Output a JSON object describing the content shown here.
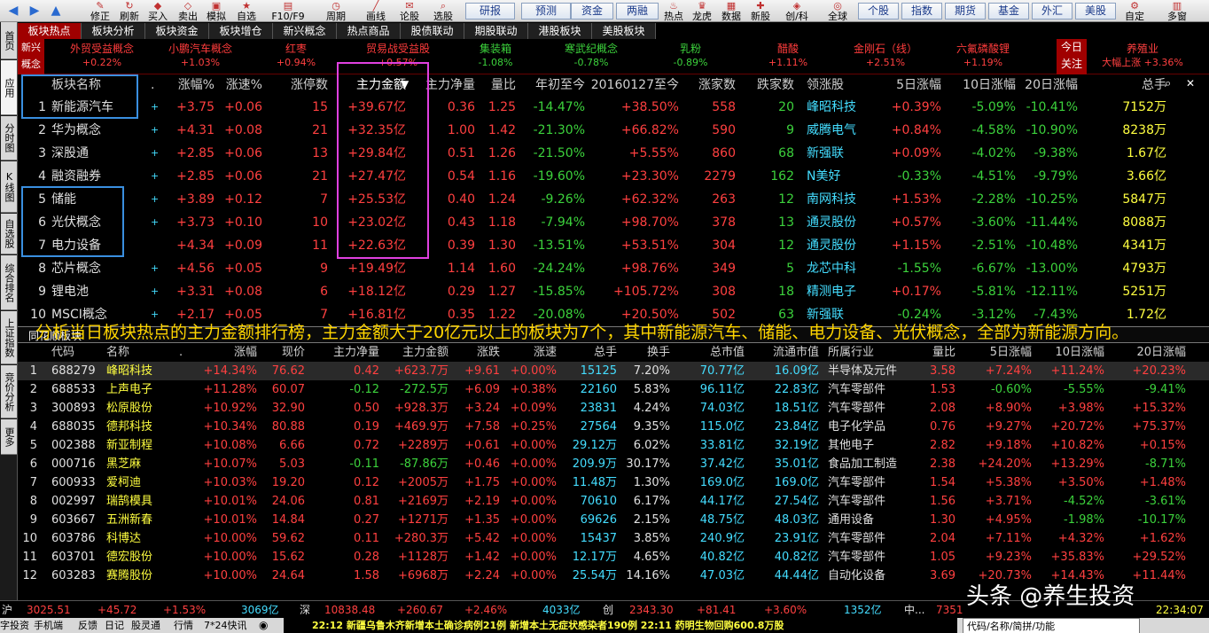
{
  "toolbar": {
    "buttons": [
      "修正",
      "刷新",
      "买入",
      "卖出",
      "模拟",
      "自选",
      "F10/F9",
      "周期",
      "画线",
      "论股",
      "选股"
    ],
    "boxes": [
      "研报",
      "预测",
      "资金",
      "两融"
    ],
    "buttons2": [
      "热点",
      "龙虎",
      "数据",
      "新股",
      "创/科",
      "全球"
    ],
    "boxes2": [
      "个股",
      "指数",
      "期货",
      "基金",
      "外汇",
      "美股"
    ],
    "right": [
      "自定",
      "多窗"
    ]
  },
  "leftbar": [
    "首页",
    "应用",
    "分时图",
    "K线图",
    "自选股",
    "综合排名",
    "上证指数",
    "竞价分析",
    "更多"
  ],
  "tabs": [
    "板块热点",
    "板块分析",
    "板块资金",
    "板块增仓",
    "新兴概念",
    "热点商品",
    "股债联动",
    "期股联动",
    "港股板块",
    "美股板块"
  ],
  "hot": {
    "label": "新兴概念",
    "items": [
      {
        "name": "外贸受益概念",
        "val": "+0.22%",
        "up": true
      },
      {
        "name": "小鹏汽车概念",
        "val": "+1.03%",
        "up": true
      },
      {
        "name": "红枣",
        "val": "+0.94%",
        "up": true
      },
      {
        "name": "贸易战受益股",
        "val": "+0.57%",
        "up": true
      },
      {
        "name": "集装箱",
        "val": "-1.08%",
        "up": false
      },
      {
        "name": "寒武纪概念",
        "val": "-0.78%",
        "up": false
      },
      {
        "name": "乳粉",
        "val": "-0.89%",
        "up": false
      },
      {
        "name": "醋酸",
        "val": "+1.11%",
        "up": true
      },
      {
        "name": "金刚石（线）",
        "val": "+2.51%",
        "up": true
      },
      {
        "name": "六氟磷酸锂",
        "val": "+1.19%",
        "up": true
      }
    ],
    "today": "今日关注",
    "today_item": {
      "name": "养殖业",
      "sub": "大幅上涨",
      "val": "+3.36%"
    }
  },
  "upper": {
    "headers": [
      "板块名称",
      ".",
      "涨幅%",
      "涨速%",
      "涨停数",
      "主力金额",
      "主力净量",
      "量比",
      "年初至今",
      "20160127至今",
      "涨家数",
      "跌家数",
      "领涨股",
      "5日涨幅",
      "10日涨幅",
      "20日涨幅",
      "总手"
    ],
    "rows": [
      {
        "i": "1",
        "n": "新能源汽车",
        "z": "+3.75",
        "s": "+0.06",
        "t": "15",
        "je": "+39.67亿",
        "jl": "0.36",
        "lb": "1.25",
        "nc": "-14.47%",
        "lj": "+38.50%",
        "zj": "558",
        "dj": "20",
        "lz": "峰昭科技",
        "d5": "+0.39%",
        "d10": "-5.09%",
        "d20": "-10.41%",
        "zs": "7152万",
        "p": "+"
      },
      {
        "i": "2",
        "n": "华为概念",
        "z": "+4.31",
        "s": "+0.08",
        "t": "21",
        "je": "+32.35亿",
        "jl": "1.00",
        "lb": "1.42",
        "nc": "-21.30%",
        "lj": "+66.82%",
        "zj": "590",
        "dj": "9",
        "lz": "威腾电气",
        "d5": "+0.84%",
        "d10": "-4.58%",
        "d20": "-10.90%",
        "zs": "8238万",
        "p": "+"
      },
      {
        "i": "3",
        "n": "深股通",
        "z": "+2.85",
        "s": "+0.06",
        "t": "13",
        "je": "+29.84亿",
        "jl": "0.51",
        "lb": "1.26",
        "nc": "-21.50%",
        "lj": "+5.55%",
        "zj": "860",
        "dj": "68",
        "lz": "新强联",
        "d5": "+0.09%",
        "d10": "-4.02%",
        "d20": "-9.38%",
        "zs": "1.67亿",
        "p": "+"
      },
      {
        "i": "4",
        "n": "融资融券",
        "z": "+2.85",
        "s": "+0.06",
        "t": "21",
        "je": "+27.47亿",
        "jl": "0.54",
        "lb": "1.16",
        "nc": "-19.60%",
        "lj": "+23.30%",
        "zj": "2279",
        "dj": "162",
        "lz": "N美好",
        "d5": "-0.33%",
        "d10": "-4.51%",
        "d20": "-9.79%",
        "zs": "3.66亿",
        "p": "+"
      },
      {
        "i": "5",
        "n": "储能",
        "z": "+3.89",
        "s": "+0.12",
        "t": "7",
        "je": "+25.53亿",
        "jl": "0.40",
        "lb": "1.24",
        "nc": "-9.26%",
        "lj": "+62.32%",
        "zj": "263",
        "dj": "12",
        "lz": "南网科技",
        "d5": "+1.53%",
        "d10": "-2.28%",
        "d20": "-10.25%",
        "zs": "5847万",
        "p": "+"
      },
      {
        "i": "6",
        "n": "光伏概念",
        "z": "+3.73",
        "s": "+0.10",
        "t": "10",
        "je": "+23.02亿",
        "jl": "0.43",
        "lb": "1.18",
        "nc": "-7.94%",
        "lj": "+98.70%",
        "zj": "378",
        "dj": "13",
        "lz": "通灵股份",
        "d5": "+0.57%",
        "d10": "-3.60%",
        "d20": "-11.44%",
        "zs": "8088万",
        "p": "+"
      },
      {
        "i": "7",
        "n": "电力设备",
        "z": "+4.34",
        "s": "+0.09",
        "t": "11",
        "je": "+22.63亿",
        "jl": "0.39",
        "lb": "1.30",
        "nc": "-13.51%",
        "lj": "+53.51%",
        "zj": "304",
        "dj": "12",
        "lz": "通灵股份",
        "d5": "+1.15%",
        "d10": "-2.51%",
        "d20": "-10.48%",
        "zs": "4341万",
        "p": ""
      },
      {
        "i": "8",
        "n": "芯片概念",
        "z": "+4.56",
        "s": "+0.05",
        "t": "9",
        "je": "+19.49亿",
        "jl": "1.14",
        "lb": "1.60",
        "nc": "-24.24%",
        "lj": "+98.76%",
        "zj": "349",
        "dj": "5",
        "lz": "龙芯中科",
        "d5": "-1.55%",
        "d10": "-6.67%",
        "d20": "-13.00%",
        "zs": "4793万",
        "p": "+"
      },
      {
        "i": "9",
        "n": "锂电池",
        "z": "+3.31",
        "s": "+0.08",
        "t": "6",
        "je": "+18.12亿",
        "jl": "0.29",
        "lb": "1.27",
        "nc": "-15.85%",
        "lj": "+105.72%",
        "zj": "308",
        "dj": "18",
        "lz": "精测电子",
        "d5": "+0.17%",
        "d10": "-5.81%",
        "d20": "-12.11%",
        "zs": "5251万",
        "p": "+"
      },
      {
        "i": "10",
        "n": "MSCI概念",
        "z": "+2.17",
        "s": "+0.05",
        "t": "7",
        "je": "+16.81亿",
        "jl": "0.35",
        "lb": "1.22",
        "nc": "-20.08%",
        "lj": "+20.50%",
        "zj": "502",
        "dj": "63",
        "lz": "新强联",
        "d5": "-0.24%",
        "d10": "-3.12%",
        "d20": "-7.43%",
        "zs": "1.72亿",
        "p": "+"
      }
    ]
  },
  "divider": {
    "left": "同花顺板块"
  },
  "overlay": "分析当日板块热点的主力金额排行榜，主力金额大于20亿元以上的板块为7个，其中新能源汽车、储能、电力设备、光伏概念，全部为新能源方向。",
  "lower": {
    "headers": [
      "代码",
      "名称",
      ".",
      "涨幅",
      "现价",
      "主力净量",
      "主力金额",
      "涨跌",
      "涨速",
      "总手",
      "换手",
      "总市值",
      "流通市值",
      "所属行业",
      "量比",
      "5日涨幅",
      "10日涨幅",
      "20日涨幅"
    ],
    "rows": [
      {
        "i": "1",
        "code": "688279",
        "n": "峰昭科技",
        "z": "+14.34%",
        "p": "76.62",
        "jl": "0.42",
        "je": "+623.7万",
        "zd": "+9.61",
        "zs": "+0.00%",
        "zsh": "15125",
        "hs": "7.20%",
        "sz": "70.77亿",
        "lt": "16.09亿",
        "hy": "半导体及元件",
        "lb": "3.58",
        "d5": "+7.24%",
        "d10": "+11.24%",
        "d20": "+20.23%"
      },
      {
        "i": "2",
        "code": "688533",
        "n": "上声电子",
        "z": "+11.28%",
        "p": "60.07",
        "jl": "-0.12",
        "je": "-272.5万",
        "zd": "+6.09",
        "zs": "+0.38%",
        "zsh": "22160",
        "hs": "5.83%",
        "sz": "96.11亿",
        "lt": "22.83亿",
        "hy": "汽车零部件",
        "lb": "1.53",
        "d5": "-0.60%",
        "d10": "-5.55%",
        "d20": "-9.41%"
      },
      {
        "i": "3",
        "code": "300893",
        "n": "松原股份",
        "z": "+10.92%",
        "p": "32.90",
        "jl": "0.50",
        "je": "+928.3万",
        "zd": "+3.24",
        "zs": "+0.09%",
        "zsh": "23831",
        "hs": "4.24%",
        "sz": "74.03亿",
        "lt": "18.51亿",
        "hy": "汽车零部件",
        "lb": "2.08",
        "d5": "+8.90%",
        "d10": "+3.98%",
        "d20": "+15.32%"
      },
      {
        "i": "4",
        "code": "688035",
        "n": "德邦科技",
        "z": "+10.34%",
        "p": "80.88",
        "jl": "0.19",
        "je": "+469.9万",
        "zd": "+7.58",
        "zs": "+0.25%",
        "zsh": "27564",
        "hs": "9.35%",
        "sz": "115.0亿",
        "lt": "23.84亿",
        "hy": "电子化学品",
        "lb": "0.76",
        "d5": "+9.27%",
        "d10": "+20.72%",
        "d20": "+75.37%"
      },
      {
        "i": "5",
        "code": "002388",
        "n": "新亚制程",
        "z": "+10.08%",
        "p": "6.66",
        "jl": "0.72",
        "je": "+2289万",
        "zd": "+0.61",
        "zs": "+0.00%",
        "zsh": "29.12万",
        "hs": "6.02%",
        "sz": "33.81亿",
        "lt": "32.19亿",
        "hy": "其他电子",
        "lb": "2.82",
        "d5": "+9.18%",
        "d10": "+10.82%",
        "d20": "+0.15%"
      },
      {
        "i": "6",
        "code": "000716",
        "n": "黑芝麻",
        "z": "+10.07%",
        "p": "5.03",
        "jl": "-0.11",
        "je": "-87.86万",
        "zd": "+0.46",
        "zs": "+0.00%",
        "zsh": "209.9万",
        "hs": "30.17%",
        "sz": "37.42亿",
        "lt": "35.01亿",
        "hy": "食品加工制造",
        "lb": "2.38",
        "d5": "+24.20%",
        "d10": "+13.29%",
        "d20": "-8.71%"
      },
      {
        "i": "7",
        "code": "600933",
        "n": "爱柯迪",
        "z": "+10.03%",
        "p": "19.20",
        "jl": "0.12",
        "je": "+2005万",
        "zd": "+1.75",
        "zs": "+0.00%",
        "zsh": "11.48万",
        "hs": "1.30%",
        "sz": "169.0亿",
        "lt": "169.0亿",
        "hy": "汽车零部件",
        "lb": "1.54",
        "d5": "+5.38%",
        "d10": "+3.50%",
        "d20": "+1.48%"
      },
      {
        "i": "8",
        "code": "002997",
        "n": "瑞鹄模具",
        "z": "+10.01%",
        "p": "24.06",
        "jl": "0.81",
        "je": "+2169万",
        "zd": "+2.19",
        "zs": "+0.00%",
        "zsh": "70610",
        "hs": "6.17%",
        "sz": "44.17亿",
        "lt": "27.54亿",
        "hy": "汽车零部件",
        "lb": "1.56",
        "d5": "+3.71%",
        "d10": "-4.52%",
        "d20": "-3.61%"
      },
      {
        "i": "9",
        "code": "603667",
        "n": "五洲新春",
        "z": "+10.01%",
        "p": "14.84",
        "jl": "0.27",
        "je": "+1271万",
        "zd": "+1.35",
        "zs": "+0.00%",
        "zsh": "69626",
        "hs": "2.15%",
        "sz": "48.75亿",
        "lt": "48.03亿",
        "hy": "通用设备",
        "lb": "1.30",
        "d5": "+4.95%",
        "d10": "-1.98%",
        "d20": "-10.17%"
      },
      {
        "i": "10",
        "code": "603786",
        "n": "科博达",
        "z": "+10.00%",
        "p": "59.62",
        "jl": "0.11",
        "je": "+280.3万",
        "zd": "+5.42",
        "zs": "+0.00%",
        "zsh": "15437",
        "hs": "3.85%",
        "sz": "240.9亿",
        "lt": "23.91亿",
        "hy": "汽车零部件",
        "lb": "2.04",
        "d5": "+7.11%",
        "d10": "+4.32%",
        "d20": "+1.62%"
      },
      {
        "i": "11",
        "code": "603701",
        "n": "德宏股份",
        "z": "+10.00%",
        "p": "15.62",
        "jl": "0.28",
        "je": "+1128万",
        "zd": "+1.42",
        "zs": "+0.00%",
        "zsh": "12.17万",
        "hs": "4.65%",
        "sz": "40.82亿",
        "lt": "40.82亿",
        "hy": "汽车零部件",
        "lb": "1.05",
        "d5": "+9.23%",
        "d10": "+35.83%",
        "d20": "+29.52%"
      },
      {
        "i": "12",
        "code": "603283",
        "n": "赛腾股份",
        "z": "+10.00%",
        "p": "24.64",
        "jl": "1.58",
        "je": "+6968万",
        "zd": "+2.24",
        "zs": "+0.00%",
        "zsh": "25.54万",
        "hs": "14.16%",
        "sz": "47.03亿",
        "lt": "44.44亿",
        "hy": "自动化设备",
        "lb": "3.69",
        "d5": "+20.73%",
        "d10": "+14.43%",
        "d20": "+11.44%"
      }
    ]
  },
  "status": {
    "sh_label": "沪",
    "sh": "3025.51",
    "sh_chg": "+45.72",
    "sh_pct": "+1.53%",
    "sh_amt": "3069亿",
    "sz_label": "深",
    "sz": "10838.48",
    "sz_chg": "+260.67",
    "sz_pct": "+2.46%",
    "sz_amt": "4033亿",
    "cy_label": "创",
    "cy": "2343.30",
    "cy_chg": "+81.41",
    "cy_pct": "+3.60%",
    "cy_amt": "1352亿",
    "zz_label": "中...",
    "zz": "7351",
    "time": "22:34:07"
  },
  "bottom": {
    "items": [
      "字投资",
      "手机端",
      "反馈",
      "日记",
      "股灵通",
      "行情",
      "7*24快讯"
    ],
    "news1": "22:12 新疆乌鲁木齐新增本土确诊病例21例 新增本土无症状感染者190例",
    "news2": "22:11 药明生物回购600.8万股",
    "search": "代码/名称/简拼/功能"
  },
  "watermark": "头条 @养生投资"
}
